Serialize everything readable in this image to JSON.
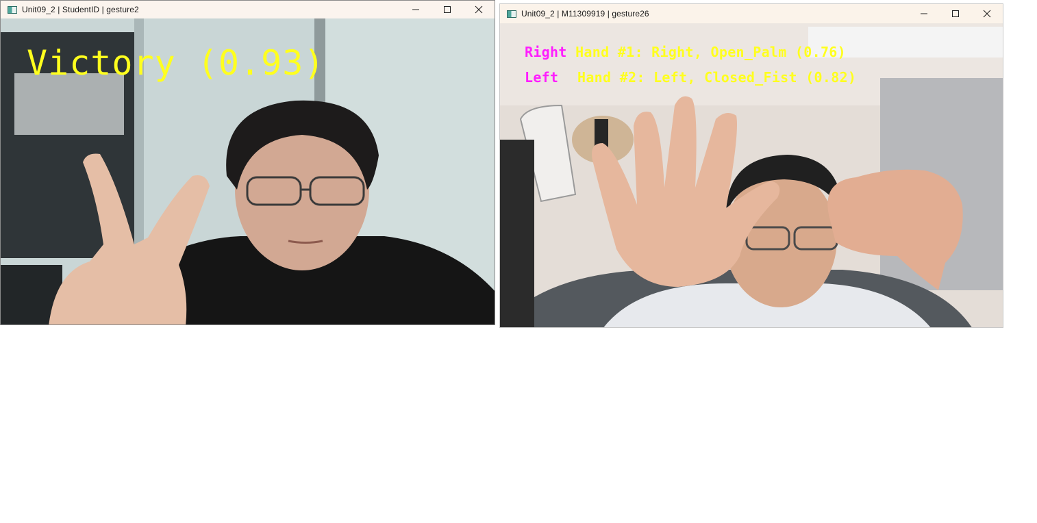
{
  "windows": [
    {
      "title": "Unit09_2 | StudentID | gesture2",
      "overlay": {
        "gesture_label": "Victory (0.93)"
      }
    },
    {
      "title": "Unit09_2 | M11309919 | gesture26",
      "overlay": {
        "hands": [
          {
            "side": "Right",
            "text": "Hand #1: Right, Open_Palm (0.76)"
          },
          {
            "side": "Left",
            "text": "Hand #2: Left, Closed_Fist (0.82)"
          }
        ]
      }
    }
  ],
  "icons": {
    "app": "app-window-icon",
    "minimize": "minimize-icon",
    "maximize": "maximize-icon",
    "close": "close-icon"
  },
  "colors": {
    "overlay_yellow": "#ffff1e",
    "overlay_magenta": "#ff1eff",
    "titlebar": "#fbf4ee"
  }
}
